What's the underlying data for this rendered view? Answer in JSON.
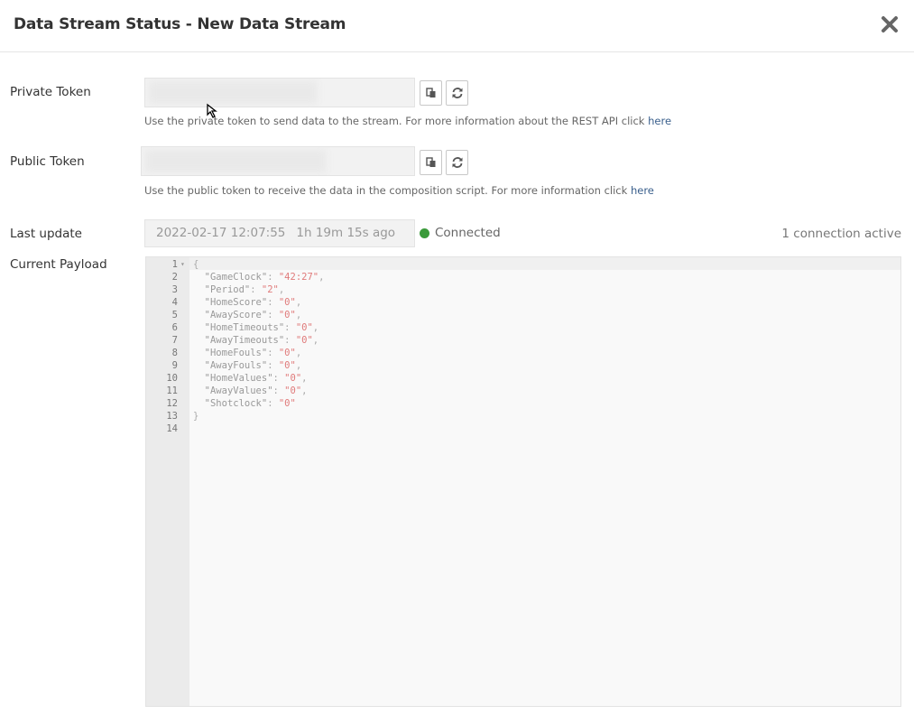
{
  "dialog": {
    "title": "Data Stream Status - New Data Stream"
  },
  "private_token": {
    "label": "Private Token",
    "help_text": "Use the private token to send data to the stream. For more information about the REST API click ",
    "help_link": "here"
  },
  "public_token": {
    "label": "Public Token",
    "help_text": "Use the public token to receive the data in the composition script. For more information click ",
    "help_link": "here"
  },
  "last_update": {
    "label": "Last update",
    "timestamp": "2022-02-17 12:07:55",
    "ago": "1h 19m 15s ago",
    "status": "Connected",
    "status_color": "#3a9a3a",
    "connections": "1 connection active"
  },
  "payload": {
    "label": "Current Payload",
    "lines": [
      {
        "n": "1",
        "open": "{"
      },
      {
        "n": "2",
        "key": "\"GameClock\"",
        "value": "\"42:27\"",
        "comma": ","
      },
      {
        "n": "3",
        "key": "\"Period\"",
        "value": "\"2\"",
        "comma": ","
      },
      {
        "n": "4",
        "key": "\"HomeScore\"",
        "value": "\"0\"",
        "comma": ","
      },
      {
        "n": "5",
        "key": "\"AwayScore\"",
        "value": "\"0\"",
        "comma": ","
      },
      {
        "n": "6",
        "key": "\"HomeTimeouts\"",
        "value": "\"0\"",
        "comma": ","
      },
      {
        "n": "7",
        "key": "\"AwayTimeouts\"",
        "value": "\"0\"",
        "comma": ","
      },
      {
        "n": "8",
        "key": "\"HomeFouls\"",
        "value": "\"0\"",
        "comma": ","
      },
      {
        "n": "9",
        "key": "\"AwayFouls\"",
        "value": "\"0\"",
        "comma": ","
      },
      {
        "n": "10",
        "key": "\"HomeValues\"",
        "value": "\"0\"",
        "comma": ","
      },
      {
        "n": "11",
        "key": "\"AwayValues\"",
        "value": "\"0\"",
        "comma": ","
      },
      {
        "n": "12",
        "key": "\"Shotclock\"",
        "value": "\"0\"",
        "comma": ""
      },
      {
        "n": "13",
        "close": "}"
      },
      {
        "n": "14"
      }
    ]
  },
  "icons": {
    "close": "close-icon",
    "copy": "copy-icon",
    "refresh": "refresh-icon",
    "status": "status-dot-icon"
  }
}
